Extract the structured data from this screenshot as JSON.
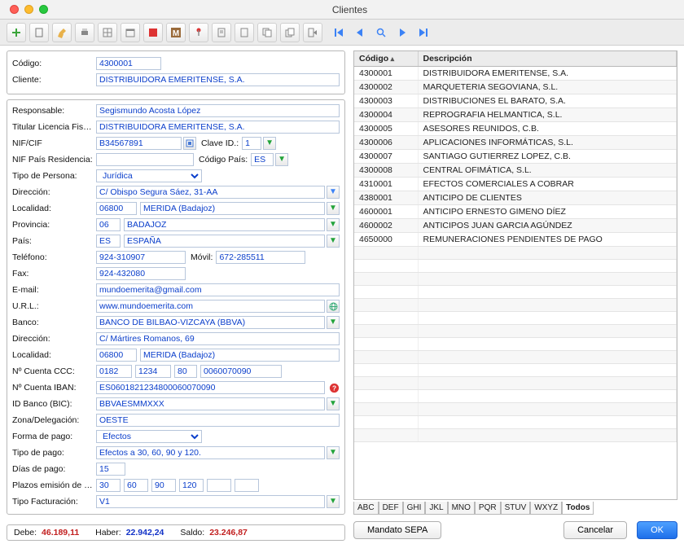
{
  "window": {
    "title": "Clientes"
  },
  "toolbar_icons": [
    "add",
    "new-doc",
    "edit",
    "print",
    "grid",
    "cal",
    "warn-red",
    "warn-m",
    "flag",
    "note",
    "doc",
    "copy",
    "dup",
    "to-right",
    "nav-first",
    "nav-prev",
    "search",
    "nav-next",
    "nav-last"
  ],
  "head": {
    "codigo_label": "Código",
    "codigo": "4300001",
    "cliente_label": "Cliente",
    "cliente": "DISTRIBUIDORA EMERITENSE, S.A."
  },
  "form": {
    "responsable_label": "Responsable",
    "responsable": "Segismundo Acosta López",
    "titular_label": "Titular Licencia Fiscal",
    "titular": "DISTRIBUIDORA EMERITENSE, S.A.",
    "nifcif_label": "NIF/CIF",
    "nifcif": "B34567891",
    "claveid_label": "Clave ID.",
    "claveid": "1",
    "nifpais_label": "NIF País Residencia",
    "nifpais": "",
    "codigopais_label": "Código País",
    "codigopais": "ES",
    "tipopersona_label": "Tipo de Persona",
    "tipopersona": "Jurídica",
    "direccion_label": "Dirección",
    "direccion": "C/ Obispo Segura Sáez, 31-AA",
    "localidad_label": "Localidad",
    "cp": "06800",
    "localidad": "MERIDA (Badajoz)",
    "provincia_label": "Provincia",
    "prov_code": "06",
    "provincia": "BADAJOZ",
    "pais_label": "País",
    "pais_code": "ES",
    "pais": "ESPAÑA",
    "telefono_label": "Teléfono",
    "telefono": "924-310907",
    "movil_label": "Móvil",
    "movil": "672-285511",
    "fax_label": "Fax",
    "fax": "924-432080",
    "email_label": "E-mail",
    "email": "mundoemerita@gmail.com",
    "url_label": "U.R.L.",
    "url": "www.mundoemerita.com",
    "banco_label": "Banco",
    "banco": "BANCO DE BILBAO-VIZCAYA (BBVA)",
    "direccion2_label": "Dirección",
    "direccion2": "C/ Mártires Romanos, 69",
    "localidad2_label": "Localidad",
    "cp2": "06800",
    "localidad2": "MERIDA (Badajoz)",
    "ccc_label": "Nº Cuenta CCC",
    "ccc_a": "0182",
    "ccc_b": "1234",
    "ccc_c": "80",
    "ccc_d": "0060070090",
    "iban_label": "Nº Cuenta IBAN",
    "iban": "ES0601821234800060070090",
    "bic_label": "ID Banco (BIC)",
    "bic": "BBVAESMMXXX",
    "zona_label": "Zona/Delegación",
    "zona": "OESTE",
    "formapago_label": "Forma de pago",
    "formapago": "Efectos",
    "tipopago_label": "Tipo de pago",
    "tipopago": "Efectos a 30, 60, 90 y 120.",
    "diaspago_label": "Días de pago",
    "diaspago": "15",
    "plazos_label": "Plazos emisión de efectos",
    "plazos": [
      "30",
      "60",
      "90",
      "120",
      "",
      ""
    ],
    "tipofact_label": "Tipo Facturación",
    "tipofact": "V1"
  },
  "totals": {
    "debe_label": "Debe:",
    "debe": "46.189,11",
    "haber_label": "Haber:",
    "haber": "22.942,24",
    "saldo_label": "Saldo:",
    "saldo": "23.246,87"
  },
  "table": {
    "col_codigo": "Código",
    "col_descripcion": "Descripción",
    "rows": [
      {
        "c": "4300001",
        "d": "DISTRIBUIDORA EMERITENSE, S.A."
      },
      {
        "c": "4300002",
        "d": "MARQUETERIA SEGOVIANA, S.L."
      },
      {
        "c": "4300003",
        "d": "DISTRIBUCIONES EL BARATO, S.A."
      },
      {
        "c": "4300004",
        "d": "REPROGRAFIA HELMANTICA, S.L."
      },
      {
        "c": "4300005",
        "d": "ASESORES REUNIDOS, C.B."
      },
      {
        "c": "4300006",
        "d": "APLICACIONES INFORMÁTICAS, S.L."
      },
      {
        "c": "4300007",
        "d": "SANTIAGO GUTIERREZ LOPEZ, C.B."
      },
      {
        "c": "4300008",
        "d": "CENTRAL OFIMÁTICA, S.L."
      },
      {
        "c": "4310001",
        "d": "EFECTOS COMERCIALES A COBRAR"
      },
      {
        "c": "4380001",
        "d": "ANTICIPO DE CLIENTES"
      },
      {
        "c": "4600001",
        "d": "ANTICIPO ERNESTO GIMENO DÍEZ"
      },
      {
        "c": "4600002",
        "d": "ANTICIPOS JUAN GARCIA AGÚNDEZ"
      },
      {
        "c": "4650000",
        "d": "REMUNERACIONES PENDIENTES DE PAGO"
      }
    ]
  },
  "alpha": [
    "ABC",
    "DEF",
    "GHI",
    "JKL",
    "MNO",
    "PQR",
    "STUV",
    "WXYZ",
    "Todos"
  ],
  "alpha_selected": "Todos",
  "buttons": {
    "mandato": "Mandato SEPA",
    "cancel": "Cancelar",
    "ok": "OK"
  }
}
